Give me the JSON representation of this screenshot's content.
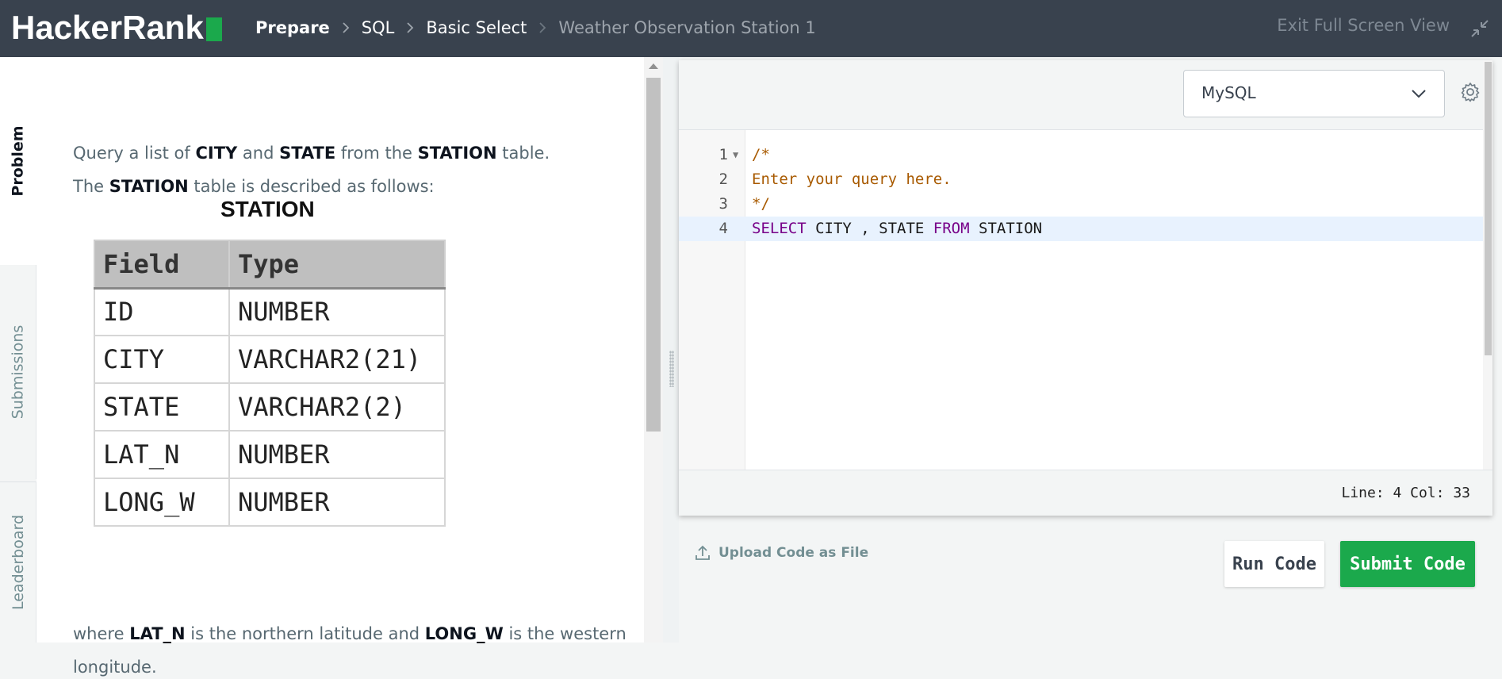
{
  "header": {
    "logo_text": "HackerRank",
    "breadcrumbs": [
      "Prepare",
      "SQL",
      "Basic Select",
      "Weather Observation Station 1"
    ],
    "exit_label": "Exit Full Screen View"
  },
  "side_tabs": {
    "problem": "Problem",
    "submissions": "Submissions",
    "leaderboard": "Leaderboard"
  },
  "problem": {
    "line1": {
      "pre": "Query a list of ",
      "city": "CITY",
      "and": " and ",
      "state": "STATE",
      "from": " from the ",
      "station": "STATION",
      "post": " table."
    },
    "line2": {
      "pre": "The ",
      "station": "STATION",
      "post": " table is described as follows:"
    },
    "table_title": "STATION",
    "table_headers": [
      "Field",
      "Type"
    ],
    "table_rows": [
      [
        "ID",
        "NUMBER"
      ],
      [
        "CITY",
        "VARCHAR2(21)"
      ],
      [
        "STATE",
        "VARCHAR2(2)"
      ],
      [
        "LAT_N",
        "NUMBER"
      ],
      [
        "LONG_W",
        "NUMBER"
      ]
    ],
    "footer": {
      "pre": "where ",
      "lat": "LAT_N",
      "mid": " is the northern latitude and ",
      "long": "LONG_W",
      "post": " is the western",
      "line2": "longitude."
    }
  },
  "editor": {
    "language": "MySQL",
    "lines": [
      {
        "num": "1",
        "text": "/*"
      },
      {
        "num": "2",
        "text": "Enter your query here."
      },
      {
        "num": "3",
        "text": "*/"
      },
      {
        "num": "4",
        "kw1": "SELECT",
        "t1": " CITY , STATE ",
        "kw2": "FROM",
        "t2": " STATION"
      }
    ],
    "status": "Line: 4 Col: 33"
  },
  "actions": {
    "upload_label": "Upload Code as File",
    "run_label": "Run Code",
    "submit_label": "Submit Code"
  },
  "colors": {
    "topbar": "#39424e",
    "brand_green": "#1ba94c",
    "comment": "#a85a00",
    "keyword": "#770088"
  }
}
